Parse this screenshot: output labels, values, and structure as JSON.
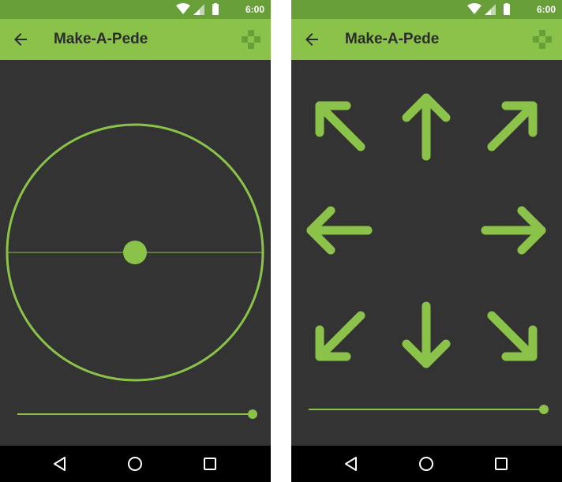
{
  "screens": [
    {
      "mode": "joystick",
      "status": {
        "time": "6:00"
      },
      "app_bar": {
        "title": "Make-A-Pede",
        "back_icon": "arrow-back-icon",
        "action_icon": "gamepad-icon"
      },
      "joystick": {
        "thumb_offset_x": 0,
        "thumb_offset_y": 0
      },
      "speed_slider": {
        "value": 1.0
      },
      "nav": {
        "back_icon": "nav-back-icon",
        "home_icon": "nav-home-icon",
        "recents_icon": "nav-recents-icon"
      }
    },
    {
      "mode": "dpad",
      "status": {
        "time": "6:00"
      },
      "app_bar": {
        "title": "Make-A-Pede",
        "back_icon": "arrow-back-icon",
        "action_icon": "gamepad-icon"
      },
      "dpad": {
        "buttons": [
          "up-left",
          "up",
          "up-right",
          "left",
          "right",
          "down-left",
          "down",
          "down-right"
        ]
      },
      "speed_slider": {
        "value": 1.0
      },
      "nav": {
        "back_icon": "nav-back-icon",
        "home_icon": "nav-home-icon",
        "recents_icon": "nav-recents-icon"
      }
    }
  ],
  "colors": {
    "accent": "#8bc34a",
    "status_bar": "#689f38",
    "background": "#333333",
    "title_text": "#2b2b2b",
    "nav_bar": "#000000"
  }
}
